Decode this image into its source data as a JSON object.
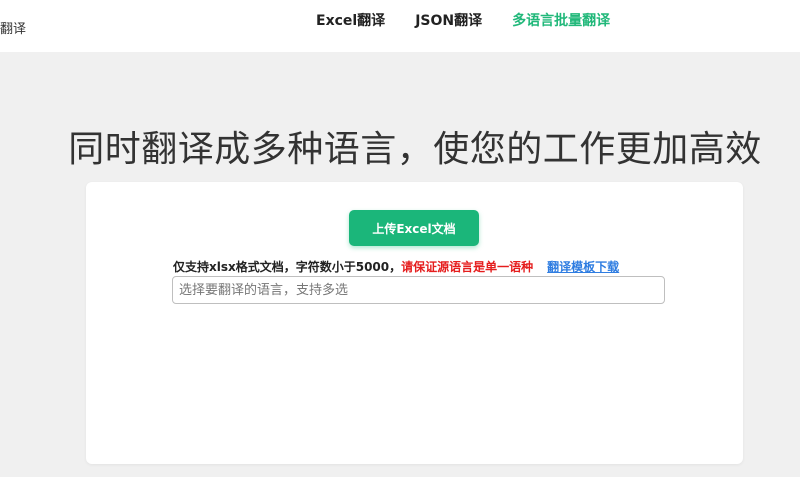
{
  "header": {
    "brand": "翻译",
    "nav": [
      {
        "label": "Excel翻译",
        "active": false
      },
      {
        "label": "JSON翻译",
        "active": false
      },
      {
        "label": "多语言批量翻译",
        "active": true
      }
    ]
  },
  "main": {
    "headline": "同时翻译成多种语言，使您的工作更加高效",
    "upload_label": "上传Excel文档",
    "notice": {
      "plain": "仅支持xlsx格式文档，字符数小于5000，",
      "warning": "请保证源语言是单一语种",
      "template_link": "翻译模板下载"
    },
    "language_select": {
      "placeholder": "选择要翻译的语言，支持多选",
      "value": ""
    }
  },
  "colors": {
    "accent": "#1bb67a",
    "warning": "#e51d1d",
    "link": "#2f7de1",
    "background": "#f0f0f0"
  }
}
